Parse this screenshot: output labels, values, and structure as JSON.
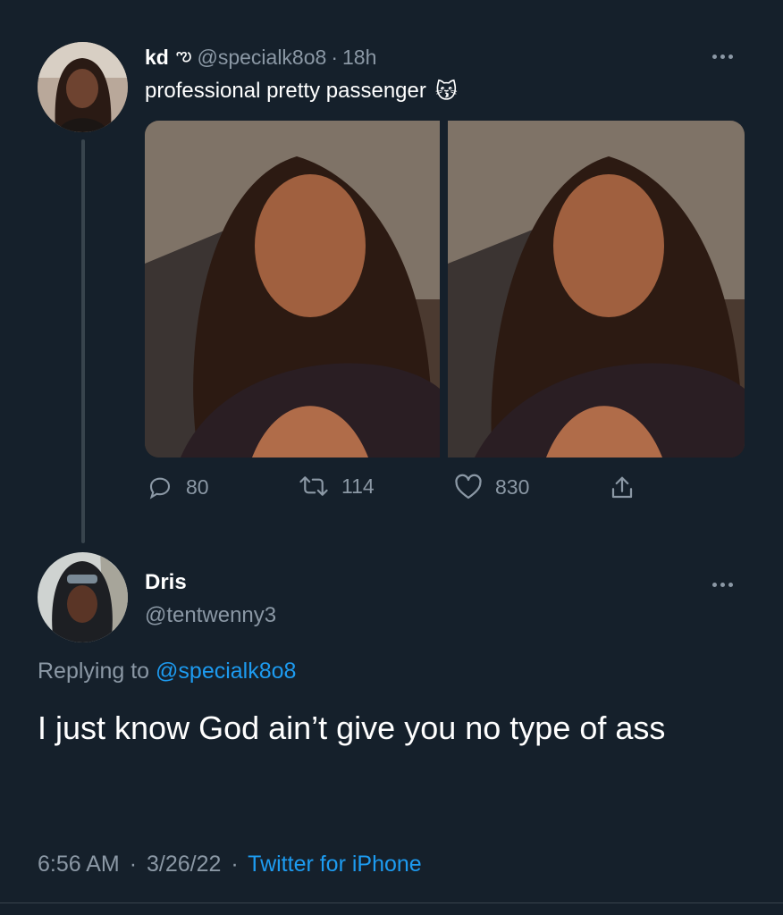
{
  "original_tweet": {
    "display_name": "kd",
    "name_symbol": "ఌ",
    "handle": "@specialk8o8",
    "separator": "·",
    "time": "18h",
    "text": "professional pretty passenger",
    "emoji": "😽",
    "stats": {
      "replies": "80",
      "retweets": "114",
      "likes": "830"
    }
  },
  "reply_tweet": {
    "display_name": "Dris",
    "handle": "@tentwenny3",
    "replying_to_prefix": "Replying to",
    "replying_to_handle": "@specialk8o8",
    "text": "I just know God ain’t give you no type of ass",
    "time": "6:56 AM",
    "separator": "·",
    "date": "3/26/22",
    "source": "Twitter for iPhone"
  },
  "colors": {
    "background": "#15202b",
    "muted": "#8b98a5",
    "accent": "#1d9bf0"
  },
  "icons": [
    "more-icon",
    "reply-icon",
    "retweet-icon",
    "like-icon",
    "share-icon"
  ]
}
